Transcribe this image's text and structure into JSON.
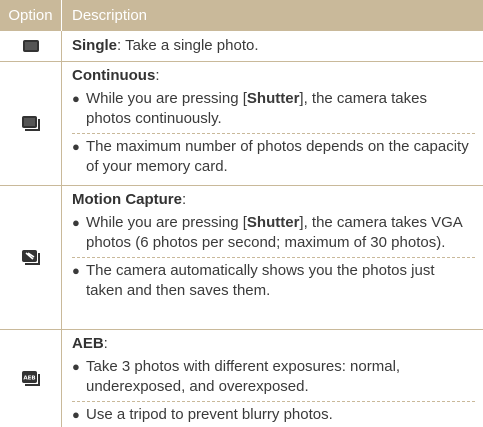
{
  "header": {
    "col1": "Option",
    "col2": "Description"
  },
  "rows": [
    {
      "icon": "single-shot-icon",
      "title": "Single",
      "title_suffix": ": Take a single photo."
    },
    {
      "icon": "continuous-shot-icon",
      "title": "Continuous",
      "title_suffix": ":",
      "bullets": [
        {
          "pre": "While you are pressing [",
          "bold": "Shutter",
          "post": "], the camera takes photos continuously."
        },
        {
          "text": "The maximum number of photos depends on the capacity of your memory card."
        }
      ]
    },
    {
      "icon": "motion-capture-icon",
      "title": "Motion Capture",
      "title_suffix": ":",
      "bullets": [
        {
          "pre": "While you are pressing [",
          "bold": "Shutter",
          "post": "], the camera takes VGA photos (6 photos per second; maximum of 30 photos)."
        },
        {
          "text": "The camera automatically shows you the photos just taken and then saves them."
        }
      ]
    },
    {
      "icon": "aeb-icon",
      "icon_text": "AEB",
      "title": "AEB",
      "title_suffix": ":",
      "bullets": [
        {
          "text": "Take 3 photos with different exposures: normal, underexposed, and overexposed."
        },
        {
          "text": "Use a tripod to prevent blurry photos."
        }
      ]
    }
  ]
}
